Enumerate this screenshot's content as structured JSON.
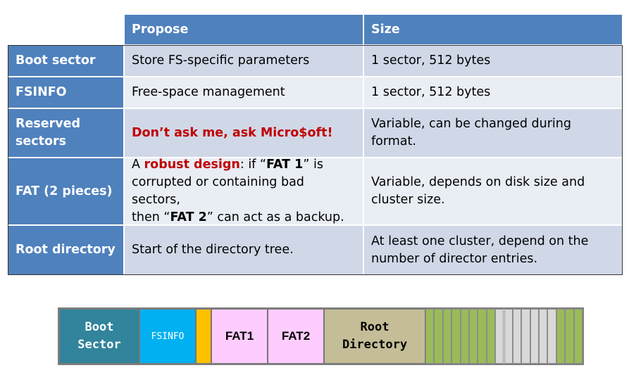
{
  "table": {
    "headers": [
      "Propose",
      "Size"
    ],
    "rows": [
      {
        "name": "Boot sector",
        "propose": "Store FS-specific parameters",
        "size": "1 sector, 512 bytes"
      },
      {
        "name": "FSINFO",
        "propose": "Free-space management",
        "size": "1 sector, 512 bytes"
      },
      {
        "name_line1": "Reserved",
        "name_line2": "sectors",
        "propose": "Don’t ask me, ask Micro$oft!",
        "size": "Variable, can be changed during format."
      },
      {
        "name": "FAT (2 pieces)",
        "propose_parts": [
          "A ",
          "robust design",
          ": if “",
          "FAT 1",
          "” is",
          "corrupted or  containing bad sectors,",
          "then “",
          "FAT 2",
          "” can act as a  backup."
        ],
        "size_line1": "Variable, depends on disk size and",
        "size_line2": "cluster size."
      },
      {
        "name": "Root directory",
        "propose": "Start of the directory tree.",
        "size_line1": "At least one cluster, depend on the",
        "size_line2": "number of director entries."
      }
    ]
  },
  "layout_diagram": {
    "boot_line1": "Boot",
    "boot_line2": "Sector",
    "fsinfo": "FSINFO",
    "fat1": "FAT1",
    "fat2": "FAT2",
    "root_line1": "Root",
    "root_line2": "Directory",
    "colors": {
      "boot": "#31849b",
      "fsinfo": "#00b0f0",
      "reserved": "#ffc000",
      "fat": "#ffccff",
      "root": "#c4bd97",
      "used": "#9bbb59",
      "free": "#d9d9d9",
      "header": "#4f81bd"
    },
    "data_clusters": [
      "used",
      "used",
      "used",
      "used",
      "used",
      "used",
      "used",
      "used",
      "free",
      "free",
      "free",
      "free",
      "free",
      "free",
      "free",
      "used",
      "used",
      "used"
    ]
  }
}
